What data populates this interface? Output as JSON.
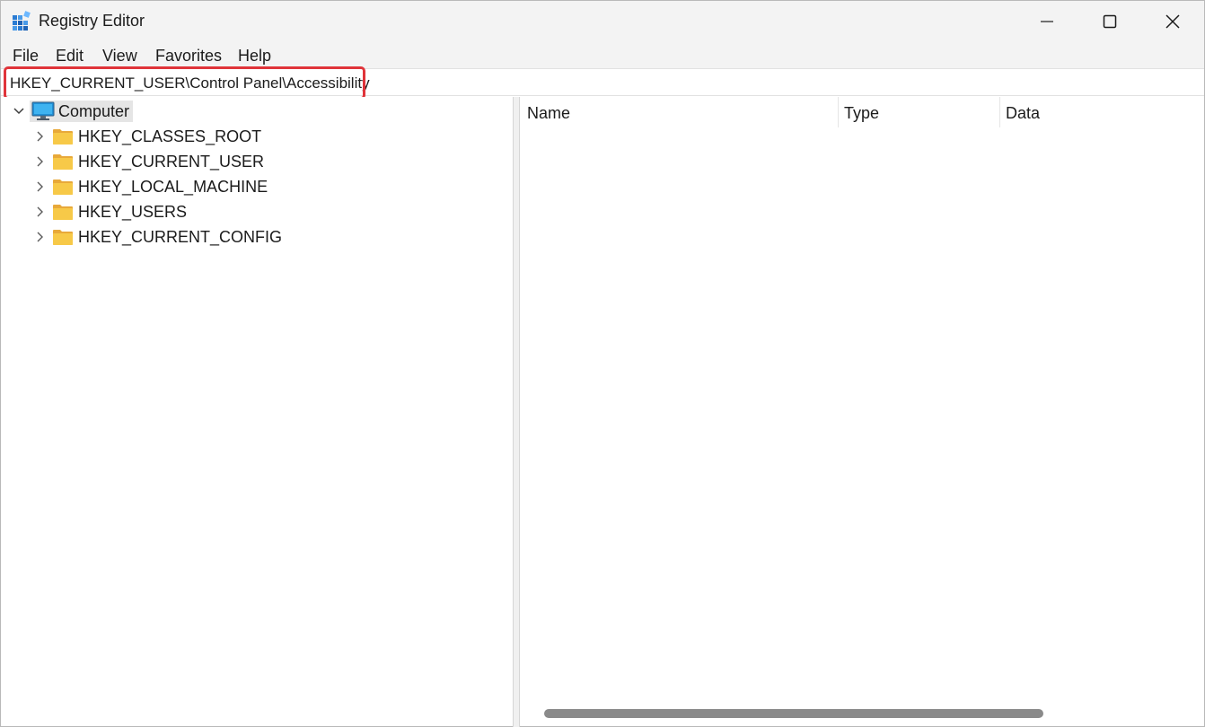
{
  "window": {
    "title": "Registry Editor"
  },
  "menu": {
    "file": "File",
    "edit": "Edit",
    "view": "View",
    "favorites": "Favorites",
    "help": "Help"
  },
  "address": {
    "path": "HKEY_CURRENT_USER\\Control Panel\\Accessibility"
  },
  "tree": {
    "root": "Computer",
    "hives": [
      "HKEY_CLASSES_ROOT",
      "HKEY_CURRENT_USER",
      "HKEY_LOCAL_MACHINE",
      "HKEY_USERS",
      "HKEY_CURRENT_CONFIG"
    ]
  },
  "list": {
    "columns": {
      "name": "Name",
      "type": "Type",
      "data": "Data"
    }
  },
  "colors": {
    "highlight": "#e0343a",
    "folder": "#f7c948",
    "selection": "#e5e5e5"
  },
  "icons": {
    "app": "registry-editor-icon",
    "computer": "computer-icon",
    "folder": "folder-icon",
    "expand": "chevron-right-icon",
    "collapse": "chevron-down-icon"
  }
}
